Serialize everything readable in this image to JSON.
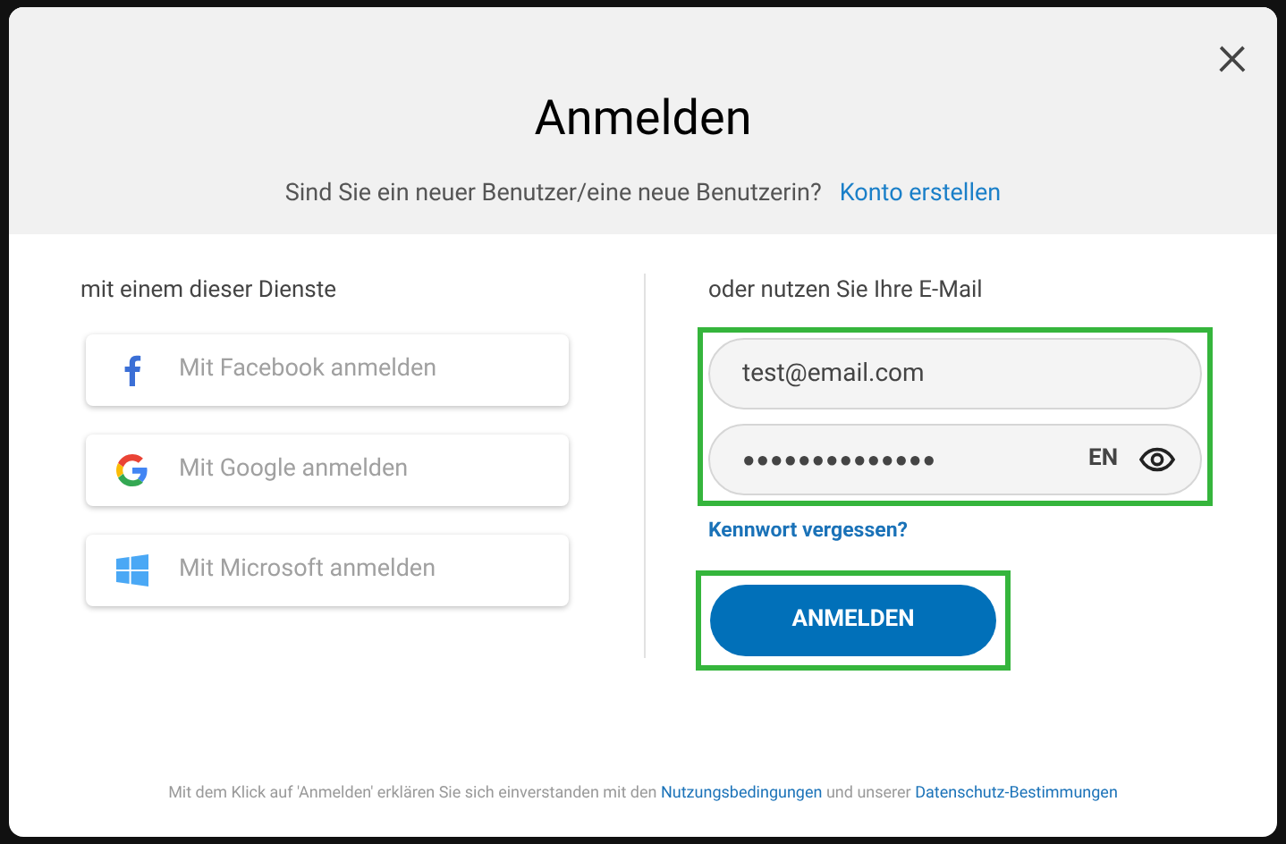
{
  "dialog": {
    "title": "Anmelden",
    "close": "×",
    "subtitle": "Sind Sie ein neuer Benutzer/eine neue Benutzerin?",
    "create_link": "Konto erstellen"
  },
  "services": {
    "heading": "mit einem dieser Dienste",
    "buttons": [
      {
        "kind": "facebook",
        "label": "Mit Facebook anmelden"
      },
      {
        "kind": "google",
        "label": "Mit Google anmelden"
      },
      {
        "kind": "microsoft",
        "label": "Mit Microsoft anmelden"
      }
    ]
  },
  "email_login": {
    "heading": "oder nutzen Sie Ihre E-Mail",
    "email": "test@email.com",
    "password": "●●●●●●●●●●●●●●",
    "language": "EN",
    "forgot_link": "Kennwort vergessen?",
    "submit": "ANMELDEN"
  },
  "footer": {
    "text_before": "Mit dem Klick auf 'Anmelden' erklären Sie sich einverstanden mit den",
    "terms_link": "Nutzungsbedingungen",
    "text_middle": "und unserer",
    "privacy_link": "Datenschutz-Bestimmungen"
  }
}
